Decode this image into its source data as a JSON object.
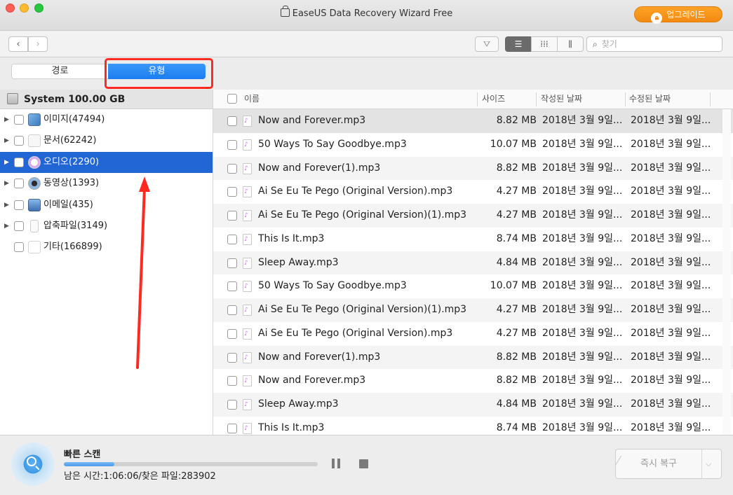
{
  "window": {
    "title": "EaseUS Data Recovery Wizard Free",
    "upgrade_label": "업그레이드"
  },
  "toolbar": {
    "back_icon": "chevron-left",
    "forward_icon": "chevron-right",
    "search_placeholder": "찾기"
  },
  "tabs": {
    "path_label": "경로",
    "type_label": "유형",
    "selected": "type"
  },
  "sidebar": {
    "drive_label": "System 100.00 GB",
    "items": [
      {
        "label": "이미지(47494)",
        "icon": "image-icon"
      },
      {
        "label": "문서(62242)",
        "icon": "document-icon"
      },
      {
        "label": "오디오(2290)",
        "icon": "audio-icon",
        "selected": true
      },
      {
        "label": "동영상(1393)",
        "icon": "video-icon"
      },
      {
        "label": "이메일(435)",
        "icon": "email-icon"
      },
      {
        "label": "압축파일(3149)",
        "icon": "archive-icon"
      },
      {
        "label": "기타(166899)",
        "icon": "file-icon"
      }
    ]
  },
  "table": {
    "headers": {
      "name": "이름",
      "size": "사이즈",
      "created": "작성된 날짜",
      "modified": "수정된 날짜"
    },
    "rows": [
      {
        "name": "Now and Forever.mp3",
        "size": "8.82 MB",
        "created": "2018년 3월 9일...",
        "modified": "2018년 3월 9일..."
      },
      {
        "name": "50 Ways To Say Goodbye.mp3",
        "size": "10.07 MB",
        "created": "2018년 3월 9일...",
        "modified": "2018년 3월 9일..."
      },
      {
        "name": "Now and Forever(1).mp3",
        "size": "8.82 MB",
        "created": "2018년 3월 9일...",
        "modified": "2018년 3월 9일..."
      },
      {
        "name": "Ai Se Eu Te Pego (Original Version).mp3",
        "size": "4.27 MB",
        "created": "2018년 3월 9일...",
        "modified": "2018년 3월 9일..."
      },
      {
        "name": "Ai Se Eu Te Pego (Original Version)(1).mp3",
        "size": "4.27 MB",
        "created": "2018년 3월 9일...",
        "modified": "2018년 3월 9일..."
      },
      {
        "name": "This Is It.mp3",
        "size": "8.74 MB",
        "created": "2018년 3월 9일...",
        "modified": "2018년 3월 9일..."
      },
      {
        "name": "Sleep Away.mp3",
        "size": "4.84 MB",
        "created": "2018년 3월 9일...",
        "modified": "2018년 3월 9일..."
      },
      {
        "name": "50 Ways To Say Goodbye.mp3",
        "size": "10.07 MB",
        "created": "2018년 3월 9일...",
        "modified": "2018년 3월 9일..."
      },
      {
        "name": "Ai Se Eu Te Pego (Original Version)(1).mp3",
        "size": "4.27 MB",
        "created": "2018년 3월 9일...",
        "modified": "2018년 3월 9일..."
      },
      {
        "name": "Ai Se Eu Te Pego (Original Version).mp3",
        "size": "4.27 MB",
        "created": "2018년 3월 9일...",
        "modified": "2018년 3월 9일..."
      },
      {
        "name": "Now and Forever(1).mp3",
        "size": "8.82 MB",
        "created": "2018년 3월 9일...",
        "modified": "2018년 3월 9일..."
      },
      {
        "name": "Now and Forever.mp3",
        "size": "8.82 MB",
        "created": "2018년 3월 9일...",
        "modified": "2018년 3월 9일..."
      },
      {
        "name": "Sleep Away.mp3",
        "size": "4.84 MB",
        "created": "2018년 3월 9일...",
        "modified": "2018년 3월 9일..."
      },
      {
        "name": "This Is It.mp3",
        "size": "8.74 MB",
        "created": "2018년 3월 9일...",
        "modified": "2018년 3월 9일..."
      }
    ]
  },
  "scan": {
    "title": "빠른 스캔",
    "status": "남은 시간:1:06:06/찾은 파일:283902",
    "progress": 0.2
  },
  "recover": {
    "label": "즉시 복구"
  },
  "colors": {
    "accent": "#1a7ef1",
    "selection": "#2266d6",
    "upgrade": "#f28a12",
    "annotation": "#ff2a1f"
  }
}
